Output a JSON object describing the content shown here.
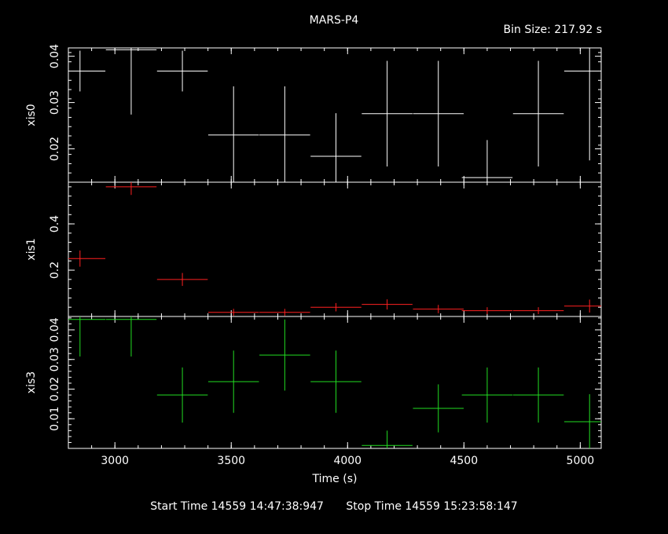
{
  "title": "MARS-P4",
  "bin_size_text": "Bin Size: 217.92 s",
  "footer": {
    "start": "Start Time 14559 14:47:38:947",
    "stop": "Stop Time 14559 15:23:58:147"
  },
  "colors": {
    "background": "#000000",
    "axes": "#ffffff",
    "xis0": "#ffffff",
    "xis1": "#ff2020",
    "xis3": "#22dd22"
  },
  "chart_data": {
    "type": "scatter",
    "xlabel": "Time (s)",
    "xlim": [
      2800,
      5090
    ],
    "x_ticks": [
      3000,
      3500,
      4000,
      4500,
      5000
    ],
    "panels": [
      {
        "name": "xis0",
        "ylabel": "xis0",
        "ylim": [
          0.0128,
          0.0418
        ],
        "y_ticks": [
          0.02,
          0.03,
          0.04
        ],
        "y_tick_labels": [
          "0.02",
          "0.03",
          "0.04"
        ],
        "points": [
          {
            "x": 2850,
            "xerr": 109,
            "y": 0.0368,
            "yerr": 0.0044
          },
          {
            "x": 3070,
            "xerr": 109,
            "y": 0.0414,
            "yerr": 0.014
          },
          {
            "x": 3290,
            "xerr": 109,
            "y": 0.0368,
            "yerr": 0.0044
          },
          {
            "x": 3510,
            "xerr": 109,
            "y": 0.023,
            "yerr": 0.0105
          },
          {
            "x": 3730,
            "xerr": 109,
            "y": 0.023,
            "yerr": 0.0105
          },
          {
            "x": 3950,
            "xerr": 109,
            "y": 0.0184,
            "yerr": 0.0093
          },
          {
            "x": 4170,
            "xerr": 109,
            "y": 0.0276,
            "yerr": 0.0114
          },
          {
            "x": 4390,
            "xerr": 109,
            "y": 0.0276,
            "yerr": 0.0114
          },
          {
            "x": 4600,
            "xerr": 109,
            "y": 0.0138,
            "yerr": 0.0081
          },
          {
            "x": 4820,
            "xerr": 109,
            "y": 0.0276,
            "yerr": 0.0114
          },
          {
            "x": 5040,
            "xerr": 109,
            "y": 0.0368,
            "yerr": 0.0193
          }
        ]
      },
      {
        "name": "xis1",
        "ylabel": "xis1",
        "ylim": [
          0.0,
          0.58
        ],
        "y_ticks": [
          0.2,
          0.4
        ],
        "y_tick_labels": [
          "0.2",
          "0.4"
        ],
        "points": [
          {
            "x": 2850,
            "xerr": 109,
            "y": 0.25,
            "yerr": 0.035
          },
          {
            "x": 3070,
            "xerr": 109,
            "y": 0.56,
            "yerr": 0.035
          },
          {
            "x": 3290,
            "xerr": 109,
            "y": 0.16,
            "yerr": 0.028
          },
          {
            "x": 3510,
            "xerr": 109,
            "y": 0.018,
            "yerr": 0.015
          },
          {
            "x": 3730,
            "xerr": 109,
            "y": 0.018,
            "yerr": 0.015
          },
          {
            "x": 3950,
            "xerr": 109,
            "y": 0.04,
            "yerr": 0.018
          },
          {
            "x": 4170,
            "xerr": 109,
            "y": 0.052,
            "yerr": 0.022
          },
          {
            "x": 4390,
            "xerr": 109,
            "y": 0.032,
            "yerr": 0.018
          },
          {
            "x": 4600,
            "xerr": 109,
            "y": 0.025,
            "yerr": 0.015
          },
          {
            "x": 4820,
            "xerr": 109,
            "y": 0.025,
            "yerr": 0.015
          },
          {
            "x": 5040,
            "xerr": 109,
            "y": 0.045,
            "yerr": 0.028
          }
        ]
      },
      {
        "name": "xis3",
        "ylabel": "xis3",
        "ylim": [
          0.0,
          0.0445
        ],
        "y_ticks": [
          0.01,
          0.02,
          0.03,
          0.04
        ],
        "y_tick_labels": [
          "0.01",
          "0.02",
          "0.03",
          "0.04"
        ],
        "points": [
          {
            "x": 2850,
            "xerr": 109,
            "y": 0.0435,
            "yerr": 0.0125
          },
          {
            "x": 3070,
            "xerr": 109,
            "y": 0.0435,
            "yerr": 0.0125
          },
          {
            "x": 3290,
            "xerr": 109,
            "y": 0.018,
            "yerr": 0.0093
          },
          {
            "x": 3510,
            "xerr": 109,
            "y": 0.0225,
            "yerr": 0.0105
          },
          {
            "x": 3730,
            "xerr": 109,
            "y": 0.0315,
            "yerr": 0.012
          },
          {
            "x": 3950,
            "xerr": 109,
            "y": 0.0225,
            "yerr": 0.0105
          },
          {
            "x": 4170,
            "xerr": 109,
            "y": 0.001,
            "yerr": 0.005
          },
          {
            "x": 4390,
            "xerr": 109,
            "y": 0.0135,
            "yerr": 0.0081
          },
          {
            "x": 4600,
            "xerr": 109,
            "y": 0.018,
            "yerr": 0.0093
          },
          {
            "x": 4820,
            "xerr": 109,
            "y": 0.018,
            "yerr": 0.0093
          },
          {
            "x": 5040,
            "xerr": 109,
            "y": 0.009,
            "yerr": 0.0093
          }
        ]
      }
    ]
  }
}
